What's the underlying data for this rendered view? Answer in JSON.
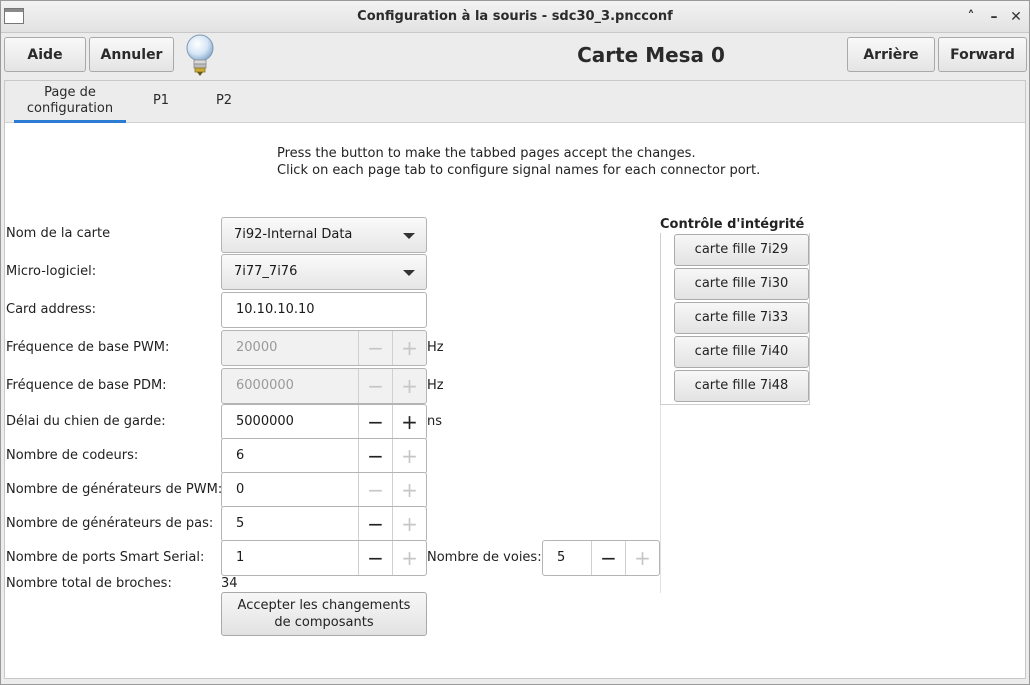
{
  "window": {
    "title": "Configuration à la souris - sdc30_3.pncconf",
    "controls": {
      "up": "˄",
      "minimize": "–",
      "close": "✕"
    }
  },
  "toolbar": {
    "help": "Aide",
    "cancel": "Annuler",
    "page_title": "Carte Mesa 0",
    "back": "Arrière",
    "forward": "Forward",
    "hint_icon": "lightbulb-icon"
  },
  "tabs": [
    {
      "label_line1": "Page de",
      "label_line2": "configuration",
      "active": true
    },
    {
      "label": "P1"
    },
    {
      "label": "P2"
    }
  ],
  "info": {
    "line1": "Press the button to make the tabbed pages accept the changes.",
    "line2": "Click on each page tab to configure signal names for each connector port."
  },
  "form": {
    "card_name": {
      "label": "Nom de la carte",
      "value": "7i92-Internal Data"
    },
    "firmware": {
      "label": "Micro-logiciel:",
      "value": "7i77_7i76"
    },
    "card_address": {
      "label": "Card address:",
      "value": "10.10.10.10"
    },
    "pwm_base_freq": {
      "label": "Fréquence de base PWM:",
      "value": "20000",
      "unit": "Hz"
    },
    "pdm_base_freq": {
      "label": "Fréquence de base PDM:",
      "value": "6000000",
      "unit": "Hz"
    },
    "watchdog": {
      "label": "Délai du chien de garde:",
      "value": "5000000",
      "unit": "ns"
    },
    "encoders": {
      "label": "Nombre de codeurs:",
      "value": "6"
    },
    "pwm_gens": {
      "label": "Nombre de générateurs de PWM:",
      "value": "0"
    },
    "stepgens": {
      "label": "Nombre de générateurs de pas:",
      "value": "5"
    },
    "sserial_ports": {
      "label": "Nombre de ports Smart Serial:",
      "value": "1"
    },
    "channels": {
      "label": "Nombre de voies:",
      "value": "5"
    },
    "total_pins": {
      "label": "Nombre total de broches:",
      "value": "34"
    },
    "accept_line1": "Accepter les changements",
    "accept_line2": "de composants",
    "spin_minus": "−",
    "spin_plus": "+"
  },
  "sanity": {
    "label": "Contrôle d'intégrité",
    "buttons": [
      "carte fille 7i29",
      "carte fille 7i30",
      "carte fille 7i33",
      "carte fille 7i40",
      "carte fille 7i48"
    ]
  }
}
